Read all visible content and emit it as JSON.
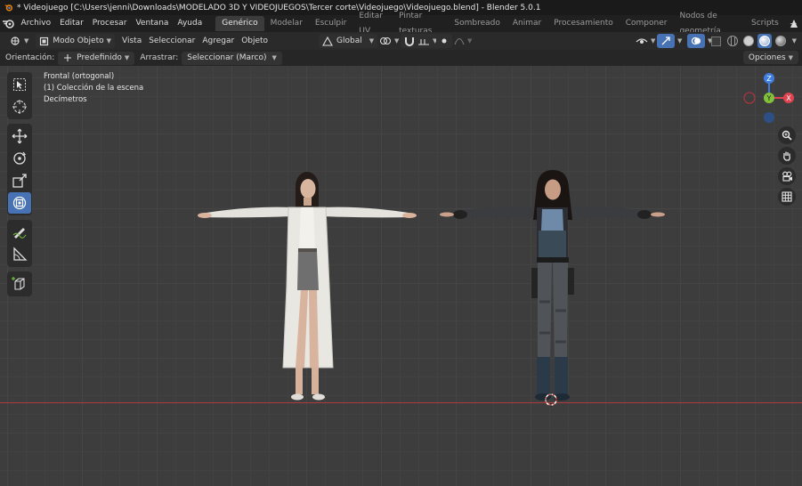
{
  "window": {
    "title": "* Videojuego [C:\\Users\\jenni\\Downloads\\MODELADO 3D Y VIDEOJUEGOS\\Tercer corte\\Videojuego\\Videojuego.blend] - Blender 5.0.1"
  },
  "menu": {
    "items": [
      "Archivo",
      "Editar",
      "Procesar",
      "Ventana",
      "Ayuda"
    ],
    "workspaces": [
      "Genérico",
      "Modelar",
      "Esculpir",
      "Editar UV",
      "Pintar texturas",
      "Sombreado",
      "Animar",
      "Procesamiento",
      "Componer",
      "Nodos de geometría",
      "Scripts"
    ],
    "active_workspace": "Genérico",
    "add_symbol": "+"
  },
  "header": {
    "mode": "Modo Objeto",
    "menus": [
      "Vista",
      "Seleccionar",
      "Agregar",
      "Objeto"
    ],
    "transform_orientation": "Global"
  },
  "tool_settings": {
    "orientation_label": "Orientación:",
    "orientation_value": "Predefinido",
    "drag_label": "Arrastrar:",
    "drag_value": "Seleccionar (Marco)",
    "options": "Opciones"
  },
  "viewport": {
    "view_name": "Frontal (ortogonal)",
    "collection": "(1) Colección de la escena",
    "units": "Decímetros",
    "gizmo": {
      "z": "Z",
      "y": "Y",
      "x": "X"
    }
  },
  "colors": {
    "accent": "#4772b3",
    "axis_x": "#e0434f",
    "axis_y": "#82c13a",
    "axis_z": "#3f7ee0",
    "grid_floor_line": "#b03a42"
  },
  "icons": {
    "tools": [
      "select-box-icon",
      "cursor-icon",
      "move-icon",
      "rotate-icon",
      "scale-icon",
      "transform-icon",
      "annotate-icon",
      "measure-icon",
      "add-cube-icon"
    ],
    "nav": [
      "zoom-icon",
      "pan-hand-icon",
      "camera-icon",
      "grid-toggle-icon"
    ]
  }
}
